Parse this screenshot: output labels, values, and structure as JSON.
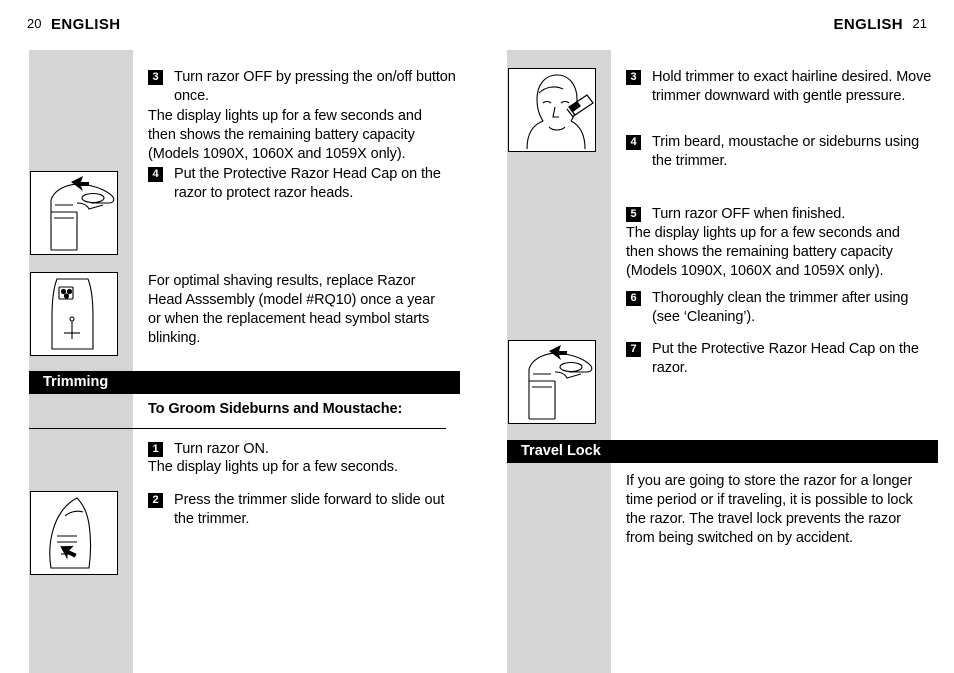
{
  "page": {
    "left_page_number": "20",
    "right_page_number": "21",
    "left_header": "ENGLISH",
    "right_header": "ENGLISH"
  },
  "left_column": {
    "steps": [
      {
        "number": "3",
        "text": "Turn razor OFF by pressing the on/off button once."
      },
      {
        "number": "4",
        "text": "Put the Protective Razor Head Cap on the razor to protect razor heads."
      },
      {
        "number": "1",
        "text": "Turn razor ON."
      },
      {
        "number": "2",
        "text": "Press the trimmer slide forward to slide out the trimmer."
      }
    ],
    "paragraphs": {
      "battery_note": "The display lights up for a few seconds and then shows the remaining battery capacity (Models 1090X, 1060X and 1059X only).",
      "replace_head": "For optimal shaving results, replace Razor Head Asssembly (model #RQ10) once a year or when the replacement head symbol starts blinking.",
      "display_note": "The display lights up for a few seconds."
    },
    "section_bar": "Trimming",
    "subheading": "To Groom Sideburns and Moustache:"
  },
  "right_column": {
    "steps": [
      {
        "number": "3",
        "text": "Hold trimmer to exact hairline desired. Move trimmer downward with gentle pressure."
      },
      {
        "number": "4",
        "text": "Trim beard, moustache or sideburns using the trimmer."
      },
      {
        "number": "5",
        "text": "Turn razor OFF when finished."
      },
      {
        "number": "6",
        "text": "Thoroughly clean the trimmer after using (see ‘Cleaning’)."
      },
      {
        "number": "7",
        "text": "Put the Protective Razor Head Cap on the razor."
      }
    ],
    "paragraphs": {
      "battery_note": "The display lights up for a few seconds and then shows the remaining battery capacity (Models 1090X, 1060X and 1059X only).",
      "travel_lock_body": "If you are going to store the razor for a longer time period or if traveling, it is possible to lock the razor. The travel lock prevents the razor from being switched on by accident."
    },
    "section_bar": "Travel Lock"
  },
  "figures": [
    {
      "name": "razor-with-head-cap-arrow",
      "side": "left"
    },
    {
      "name": "razor-display-replacement-head-symbol",
      "side": "left"
    },
    {
      "name": "razor-trimmer-slide-out",
      "side": "left"
    },
    {
      "name": "man-trimming-sideburn",
      "side": "right"
    },
    {
      "name": "razor-with-head-cap-arrow",
      "side": "right"
    }
  ],
  "colors": {
    "band": "#d5d5d5",
    "bar": "#000000",
    "text": "#000000",
    "page_background": "#ffffff"
  }
}
